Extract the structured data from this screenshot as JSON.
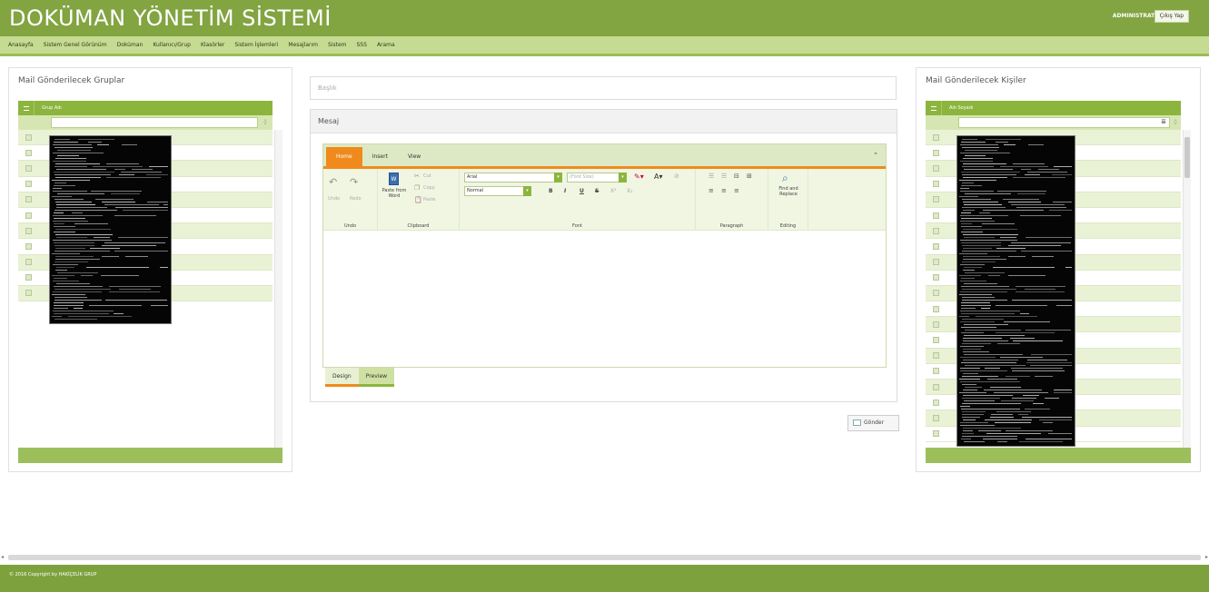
{
  "header": {
    "title": "DOKÜMAN YÖNETİM SİSTEMİ",
    "user": "ADMINISTRATOR",
    "logout_label": "Çıkış Yap"
  },
  "menu": [
    "Anasayfa",
    "Sistem Genel Görünüm",
    "Doküman",
    "Kullanıcı/Grup",
    "Klasörler",
    "Sistem İşlemleri",
    "Mesajlarım",
    "Sistem",
    "SSS",
    "Arama"
  ],
  "left_panel": {
    "title": "Mail Gönderilecek Gruplar",
    "column_header": "Grup Adı",
    "row_count": 11
  },
  "right_panel": {
    "title": "Mail Gönderilecek Kişiler",
    "column_header": "Adı Soyadı",
    "row_count": 20
  },
  "subject": {
    "placeholder": "Başlık"
  },
  "message": {
    "title": "Mesaj",
    "tabs": [
      "Home",
      "Insert",
      "View"
    ],
    "ribbon": {
      "undo": "Undo",
      "redo": "Redo",
      "undo_group": "Undo",
      "paste_word": "Paste from Word",
      "cut": "Cut",
      "copy": "Copy",
      "paste": "Paste",
      "clipboard_group": "Clipboard",
      "font_name": "Arial",
      "font_size_placeholder": "(Font Size)",
      "paragraph_style": "Normal",
      "font_group": "Font",
      "paragraph_group": "Paragraph",
      "find_replace": "Find and Replace",
      "editing_group": "Editing"
    },
    "mode_tabs": [
      "Design",
      "Preview"
    ]
  },
  "send_label": "Gönder",
  "footer": {
    "copyright": "© 2016 Copyright by HAKİÇELİK GRUP"
  }
}
